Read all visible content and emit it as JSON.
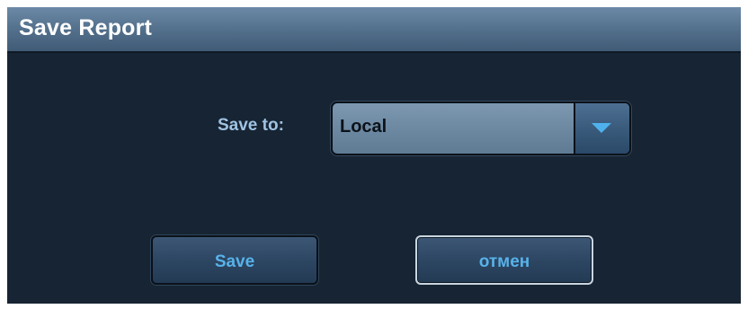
{
  "dialog": {
    "title": "Save Report"
  },
  "form": {
    "save_to_label": "Save to:",
    "save_to_value": "Local"
  },
  "buttons": {
    "save_label": "Save",
    "cancel_label": "отмен"
  },
  "icons": {
    "dropdown": "chevron-down-icon"
  },
  "colors": {
    "background": "#172433",
    "title_text": "#ffffff",
    "label_text": "#9fc3e3",
    "button_text": "#58b2ea",
    "arrow": "#4fb1ec"
  }
}
